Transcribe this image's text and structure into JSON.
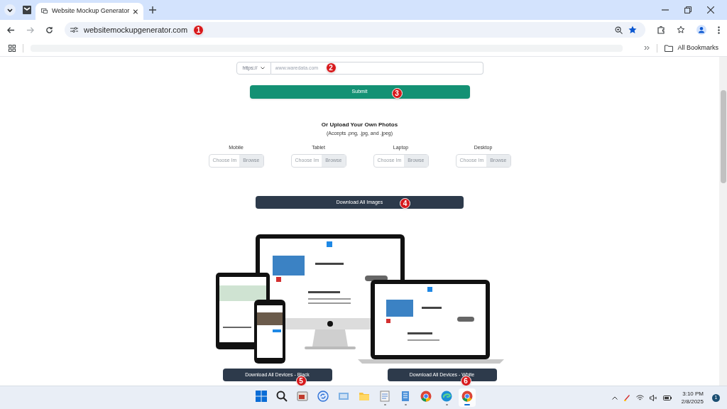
{
  "browser": {
    "tabs": [
      {
        "title": "Website Mockup Generator",
        "selected": true
      }
    ],
    "address": "websitemockupgenerator.com",
    "address_callout": "1",
    "bookmarks_label": "All Bookmarks"
  },
  "form": {
    "protocol": "https://",
    "url_placeholder": "www.waredata.com",
    "url_callout": "2",
    "submit": "Submit",
    "submit_callout": "3"
  },
  "upload": {
    "title": "Or Upload Your Own Photos",
    "subtitle": "(Accepts .png, .jpg, and .jpeg)",
    "slots": [
      {
        "label": "Mobile",
        "placeholder": "Choose Im",
        "button": "Browse"
      },
      {
        "label": "Tablet",
        "placeholder": "Choose Im",
        "button": "Browse"
      },
      {
        "label": "Laptop",
        "placeholder": "Choose Im",
        "button": "Browse"
      },
      {
        "label": "Desktop",
        "placeholder": "Choose Im",
        "button": "Browse"
      }
    ]
  },
  "download_all": {
    "label": "Download All Images",
    "callout": "4"
  },
  "device_buttons": [
    {
      "label": "Download All Devices - Black",
      "callout": "5"
    },
    {
      "label": "Download All Devices - White",
      "callout": "6"
    }
  ],
  "taskbar": {
    "apps": [
      {
        "kind": "start",
        "running": false,
        "selected": false
      },
      {
        "kind": "search",
        "running": false,
        "selected": false
      },
      {
        "kind": "photos",
        "running": false,
        "selected": false
      },
      {
        "kind": "sync",
        "running": false,
        "selected": false
      },
      {
        "kind": "display",
        "running": false,
        "selected": false
      },
      {
        "kind": "folder",
        "running": false,
        "selected": false
      },
      {
        "kind": "notepad",
        "running": true,
        "selected": false
      },
      {
        "kind": "document",
        "running": true,
        "selected": false
      },
      {
        "kind": "chrome",
        "running": false,
        "selected": false
      },
      {
        "kind": "edge",
        "running": true,
        "selected": false
      },
      {
        "kind": "chrome",
        "running": true,
        "selected": true
      }
    ],
    "time": "3:10 PM",
    "date": "2/8/2025",
    "notifications": "1"
  }
}
